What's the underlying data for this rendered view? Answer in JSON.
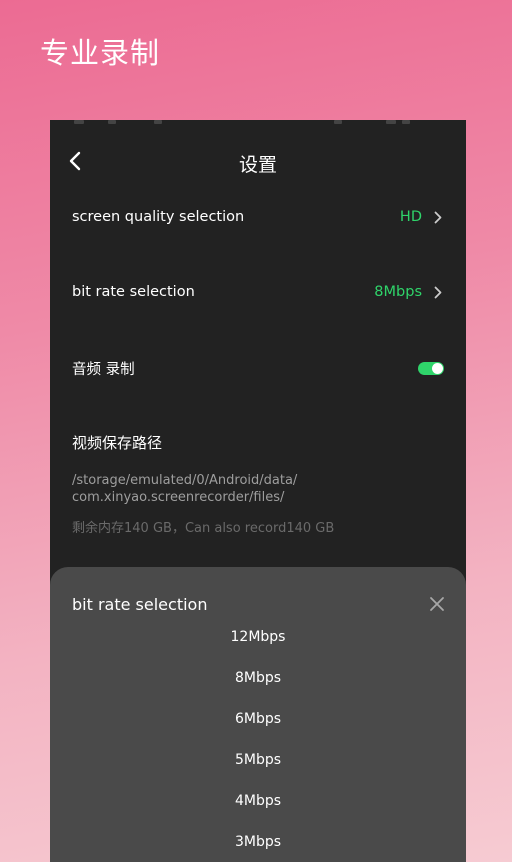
{
  "promo": {
    "title": "专业录制"
  },
  "header": {
    "title": "设置"
  },
  "settings": {
    "quality": {
      "label": "screen quality selection",
      "value": "HD"
    },
    "bitrate": {
      "label": "bit rate selection",
      "value": "8Mbps"
    },
    "audio": {
      "label": "音频 录制",
      "enabled": true
    },
    "save_path": {
      "heading": "视频保存路径",
      "path_line1": "/storage/emulated/0/Android/data/",
      "path_line2": "com.xinyao.screenrecorder/files/",
      "storage_info": "剩余内存140 GB，Can also record140 GB"
    }
  },
  "sheet": {
    "title": "bit rate selection",
    "options": [
      "12Mbps",
      "8Mbps",
      "6Mbps",
      "5Mbps",
      "4Mbps",
      "3Mbps"
    ]
  },
  "colors": {
    "accent": "#2fd46a",
    "background_top": "#ec6b93",
    "background_bottom": "#f6cbd2",
    "panel": "#222222",
    "sheet": "#4a4a4a"
  },
  "icons": {
    "back": "chevron-left-icon",
    "row_chevron": "chevron-right-icon",
    "close": "close-icon"
  }
}
